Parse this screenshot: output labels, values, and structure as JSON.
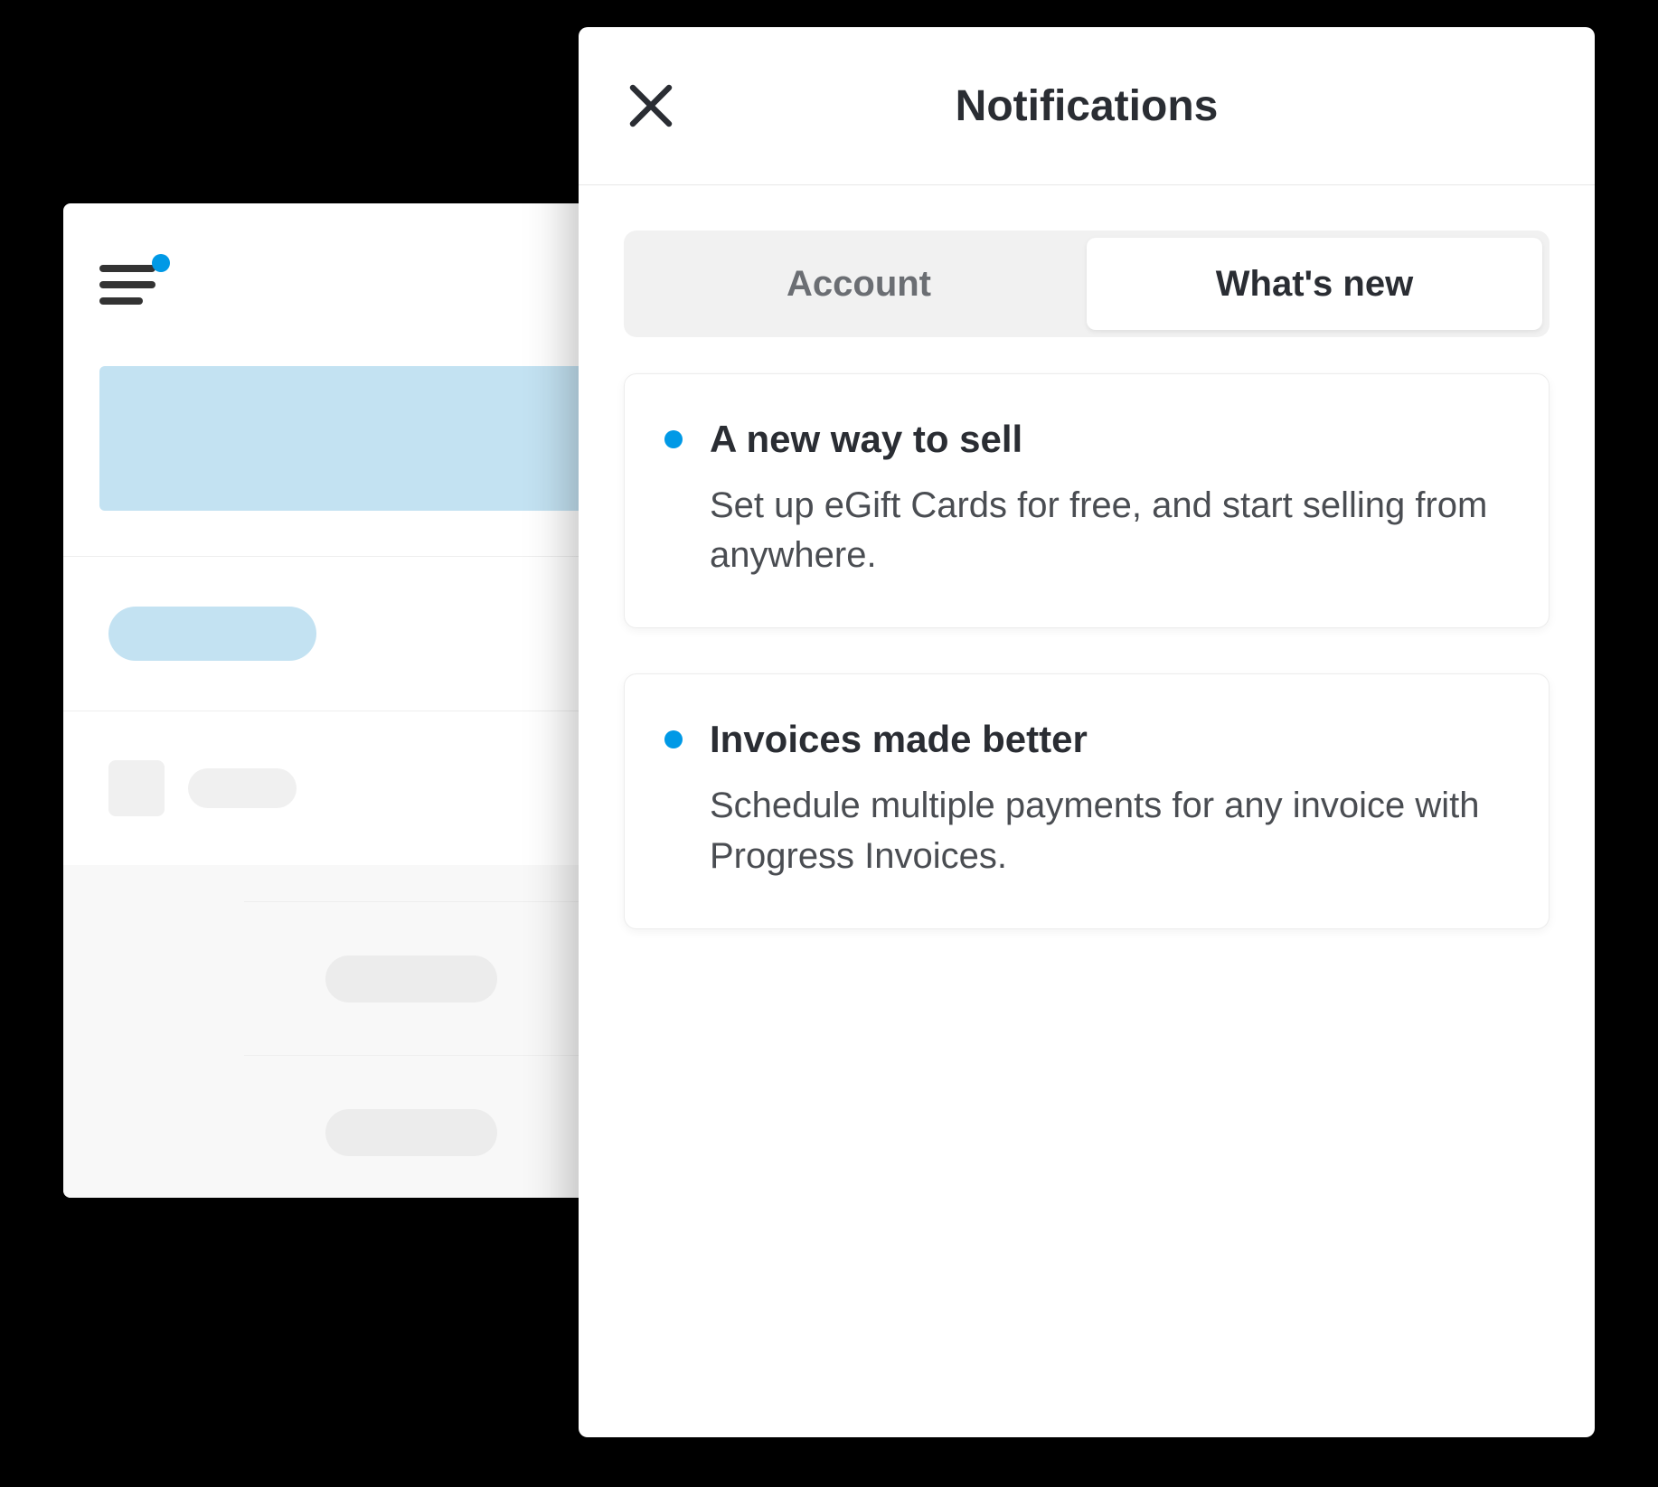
{
  "header": {
    "title": "Notifications"
  },
  "tabs": {
    "account": "Account",
    "whatsnew": "What's new"
  },
  "cards": [
    {
      "title": "A new way to sell",
      "body": "Set up eGift Cards for free, and start selling from anywhere."
    },
    {
      "title": "Invoices made better",
      "body": "Schedule multiple payments for any invoice with Progress Invoices."
    }
  ]
}
